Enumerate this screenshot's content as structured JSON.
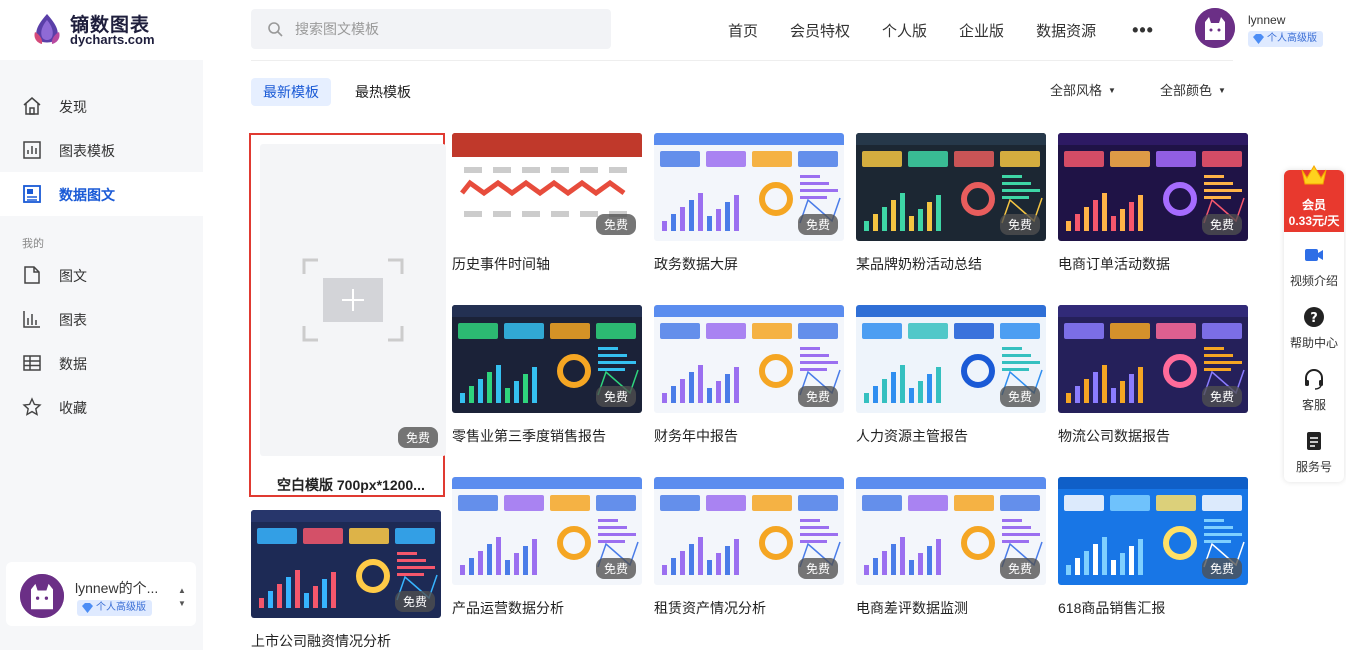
{
  "app": {
    "logo_cn": "镝数图表",
    "logo_en": "dycharts.com"
  },
  "search": {
    "placeholder": "搜索图文模板"
  },
  "nav": {
    "items": [
      "首页",
      "会员特权",
      "个人版",
      "企业版",
      "数据资源"
    ],
    "more": "•••"
  },
  "user": {
    "name": "lynnew",
    "badge": "个人高级版",
    "side_name": "lynnew的个...",
    "side_badge": "个人高级版"
  },
  "sidebar": {
    "items": [
      {
        "label": "发现",
        "icon": "home-icon"
      },
      {
        "label": "图表模板",
        "icon": "chart-template-icon"
      },
      {
        "label": "数据图文",
        "icon": "data-graphic-icon"
      }
    ],
    "section": "我的",
    "mine": [
      {
        "label": "图文",
        "icon": "document-icon"
      },
      {
        "label": "图表",
        "icon": "bar-chart-icon"
      },
      {
        "label": "数据",
        "icon": "table-icon"
      },
      {
        "label": "收藏",
        "icon": "star-icon"
      }
    ]
  },
  "tabs": [
    "最新模板",
    "最热模板"
  ],
  "filters": [
    "全部风格",
    "全部颜色"
  ],
  "blank": {
    "title": "空白模版 700px*1200...",
    "tag": "免费"
  },
  "free_tag": "免费",
  "cards": [
    {
      "title": "历史事件时间轴",
      "style": "timeline"
    },
    {
      "title": "政务数据大屏",
      "style": "light"
    },
    {
      "title": "某品牌奶粉活动总结",
      "style": "dark"
    },
    {
      "title": "电商订单活动数据",
      "style": "purple"
    },
    {
      "title": "零售业第三季度销售报告",
      "style": "darkgreen"
    },
    {
      "title": "财务年中报告",
      "style": "light"
    },
    {
      "title": "人力资源主管报告",
      "style": "lightblue"
    },
    {
      "title": "物流公司数据报告",
      "style": "purple2"
    },
    {
      "title": "产品运营数据分析",
      "style": "light"
    },
    {
      "title": "租赁资产情况分析",
      "style": "light"
    },
    {
      "title": "电商差评数据监测",
      "style": "light"
    },
    {
      "title": "618商品销售汇报",
      "style": "blue"
    },
    {
      "title": "上市公司融资情况分析",
      "style": "navy"
    }
  ],
  "floating": {
    "vip_line1": "会员",
    "vip_line2": "0.33元/天",
    "items": [
      "视频介绍",
      "帮助中心",
      "客服",
      "服务号"
    ]
  }
}
